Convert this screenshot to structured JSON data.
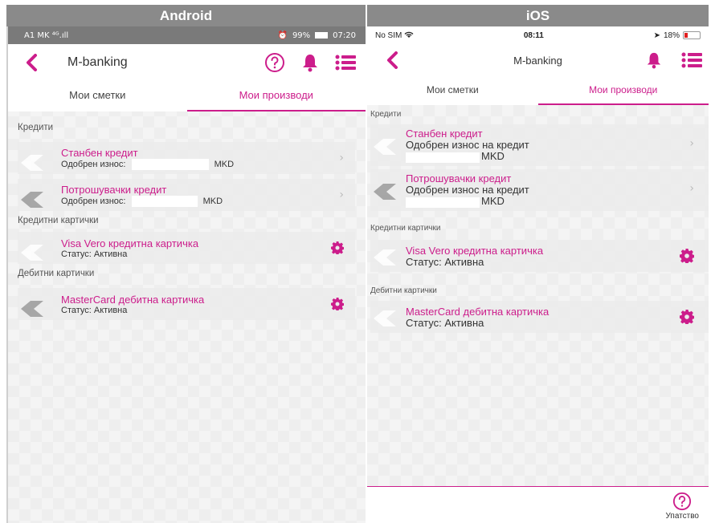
{
  "headers": {
    "android": "Android",
    "ios": "iOS"
  },
  "android": {
    "status": {
      "carrier": "A1 MK",
      "signal": "⁴ᴳ.ıll",
      "alarm": "⏰",
      "battery": "99%",
      "time": "07:20"
    },
    "app_title": "M-banking",
    "tabs": [
      {
        "label": "Мои сметки",
        "active": false
      },
      {
        "label": "Мои производи",
        "active": true
      }
    ],
    "loans_label": "Кредити",
    "loans": [
      {
        "title": "Станбен кредит",
        "sub": "Одобрен износ:",
        "currency": "MKD"
      },
      {
        "title": "Потрошувачки кредит",
        "sub": "Одобрен износ:",
        "currency": "MKD"
      }
    ],
    "credit_label": "Кредитни картички",
    "credit_cards": [
      {
        "title": "Visa Vero кредитна картичка",
        "sub": "Статус: Активна"
      }
    ],
    "debit_label": "Дебитни картички",
    "debit_cards": [
      {
        "title": "MasterCard дебитна картичка",
        "sub": "Статус: Активна"
      }
    ]
  },
  "ios": {
    "status": {
      "carrier": "No SIM",
      "time": "08:11",
      "battery": "18%"
    },
    "app_title": "M-banking",
    "tabs": [
      {
        "label": "Мои сметки",
        "active": false
      },
      {
        "label": "Мои производи",
        "active": true
      }
    ],
    "loans_label": "Кредити",
    "loans": [
      {
        "title": "Станбен кредит",
        "sub": "Одобрен износ на кредит",
        "currency": "MKD"
      },
      {
        "title": "Потрошувачки кредит",
        "sub": "Одобрен износ на кредит",
        "currency": "MKD"
      }
    ],
    "credit_label": "Кредитни картички",
    "credit_cards": [
      {
        "title": "Visa Vero кредитна картичка",
        "sub": "Статус: Активна"
      }
    ],
    "debit_label": "Дебитни картички",
    "debit_cards": [
      {
        "title": "MasterCard дебитна картичка",
        "sub": "Статус: Активна"
      }
    ],
    "bottom_help_label": "Упатство"
  },
  "colors": {
    "accent": "#cc1d8b",
    "header_bg": "#8a8a8a",
    "card_bg": "#ebebeb"
  },
  "icons": {
    "back": "chevron-left-icon",
    "help": "question-circle-icon",
    "notifications": "bell-icon",
    "menu": "list-icon",
    "settings": "gear-icon",
    "product": "product-logo-icon"
  }
}
